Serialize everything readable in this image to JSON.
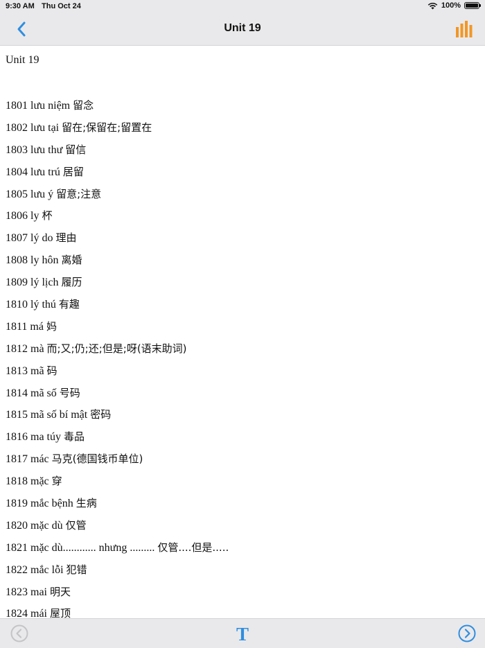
{
  "status_bar": {
    "time": "9:30 AM",
    "date": "Thu Oct 24",
    "battery": "100%",
    "battery_level": 1.0,
    "icons": [
      "wifi-icon",
      "battery-icon"
    ]
  },
  "nav": {
    "title": "Unit 19",
    "back_icon": "chevron-left-icon",
    "right_icon": "bar-chart-icon"
  },
  "content": {
    "heading": "Unit 19",
    "entries": [
      {
        "num": "1801",
        "vi": "lưu niệm",
        "cn": "留念"
      },
      {
        "num": "1802",
        "vi": "lưu tại",
        "cn": "留在;保留在;留置在"
      },
      {
        "num": "1803",
        "vi": "lưu thư",
        "cn": "留信"
      },
      {
        "num": "1804",
        "vi": "lưu trú",
        "cn": "居留"
      },
      {
        "num": "1805",
        "vi": "lưu ý",
        "cn": "留意;注意"
      },
      {
        "num": "1806",
        "vi": "ly",
        "cn": "杯"
      },
      {
        "num": "1807",
        "vi": "lý do",
        "cn": "理由"
      },
      {
        "num": "1808",
        "vi": "ly hôn",
        "cn": "离婚"
      },
      {
        "num": "1809",
        "vi": "lý lịch",
        "cn": "履历"
      },
      {
        "num": "1810",
        "vi": "lý thú",
        "cn": "有趣"
      },
      {
        "num": "1811",
        "vi": "má",
        "cn": "妈"
      },
      {
        "num": "1812",
        "vi": "mà",
        "cn": "而;又;仍;还;但是;呀(语末助词)"
      },
      {
        "num": "1813",
        "vi": "mã",
        "cn": "码"
      },
      {
        "num": "1814",
        "vi": "mã số",
        "cn": "号码"
      },
      {
        "num": "1815",
        "vi": "mã số bí mật",
        "cn": "密码"
      },
      {
        "num": "1816",
        "vi": "ma túy",
        "cn": "毒品"
      },
      {
        "num": "1817",
        "vi": "mác",
        "cn": "马克(德国钱币单位)"
      },
      {
        "num": "1818",
        "vi": "mặc",
        "cn": "穿"
      },
      {
        "num": "1819",
        "vi": "mắc bệnh",
        "cn": "生病"
      },
      {
        "num": "1820",
        "vi": "mặc dù",
        "cn": "仅管"
      },
      {
        "num": "1821",
        "vi": "mặc dù............ nhưng .........",
        "cn": "仅管....但是....."
      },
      {
        "num": "1822",
        "vi": "mắc lỗi",
        "cn": "犯错"
      },
      {
        "num": "1823",
        "vi": "mai",
        "cn": "明天"
      },
      {
        "num": "1824",
        "vi": "mái",
        "cn": "屋顶"
      }
    ]
  },
  "toolbar": {
    "prev_icon": "circle-chevron-left-icon",
    "font_label": "T",
    "next_icon": "circle-chevron-right-icon"
  },
  "colors": {
    "accent_blue": "#2f8ee0",
    "accent_orange": "#f29624",
    "disabled_gray": "#c4c4c8",
    "bar_background": "#e9e9eb"
  }
}
